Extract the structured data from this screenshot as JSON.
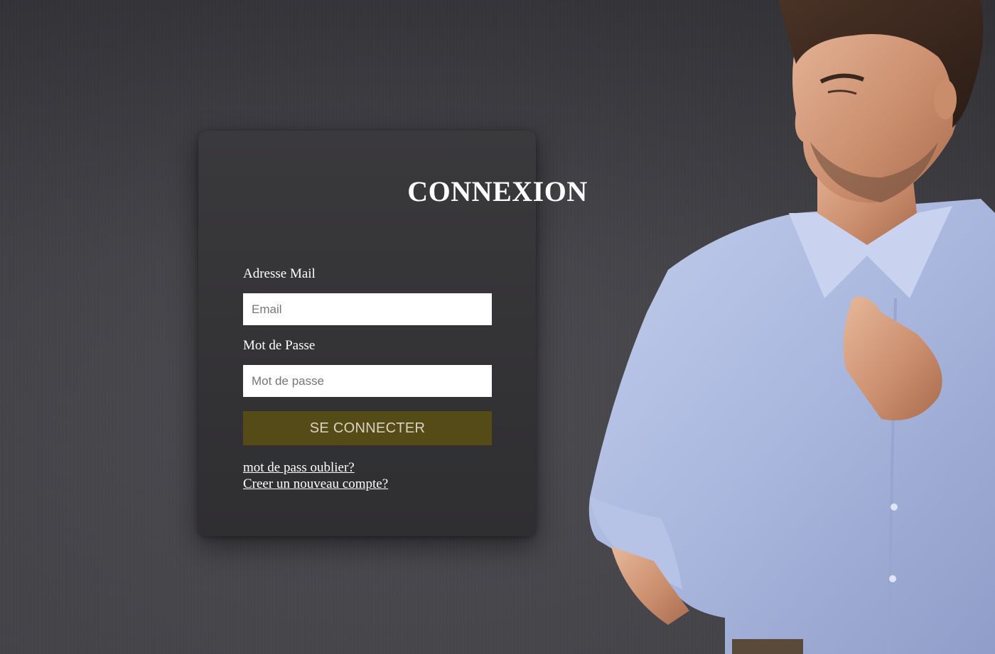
{
  "login": {
    "title": "CONNEXION",
    "email_label": "Adresse Mail",
    "email_placeholder": "Email",
    "email_value": "",
    "password_label": "Mot de Passe",
    "password_placeholder": "Mot de passe",
    "password_value": "",
    "submit_label": "SE CONNECTER",
    "forgot_link": "mot de pass oublier?",
    "register_link": "Creer un nouveau compte?"
  },
  "theme": {
    "background": "#45454a",
    "card": "#363538",
    "button": "#554b16",
    "button_text": "#d9d3c4",
    "text": "#ffffff",
    "shirt": "#aab8dc"
  },
  "hero": {
    "icon": "model-photo"
  }
}
